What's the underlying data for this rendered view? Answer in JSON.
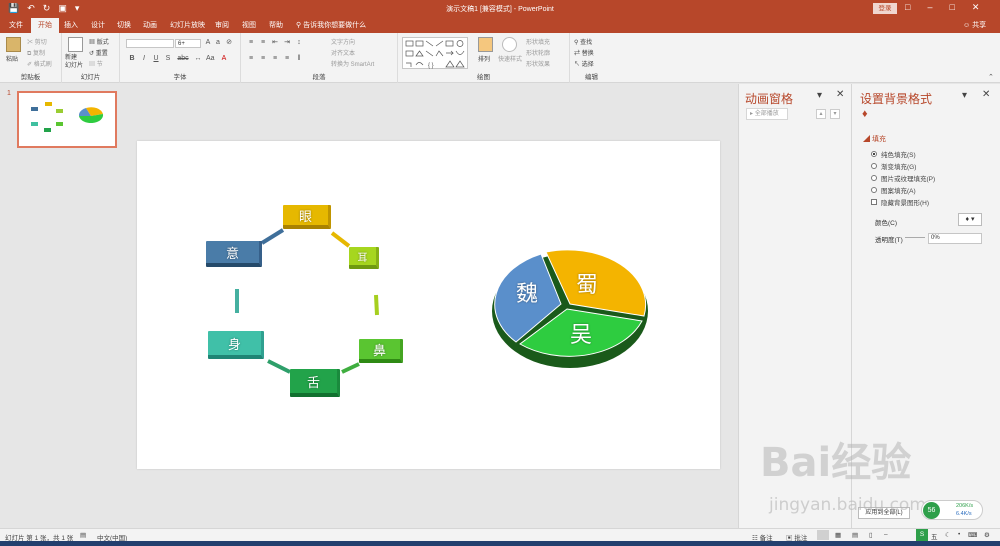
{
  "window": {
    "title": "演示文稿1 [兼容模式] - PowerPoint",
    "login_label": "登录",
    "share_label": "共享"
  },
  "tabs": [
    "文件",
    "开始",
    "插入",
    "设计",
    "切换",
    "动画",
    "幻灯片放映",
    "审阅",
    "视图",
    "帮助"
  ],
  "active_tab": "开始",
  "tell_me": "告诉我你想要做什么",
  "ribbon": {
    "clipboard": {
      "paste": "粘贴",
      "cut": "剪切",
      "copy": "复制",
      "format_painter": "格式刷",
      "label": "剪贴板"
    },
    "slides": {
      "new_slide": "新建\n幻灯片",
      "layout": "版式",
      "reset": "重置",
      "section": "节",
      "label": "幻灯片"
    },
    "font": {
      "size": "6+",
      "label": "字体",
      "bold": "B",
      "italic": "I",
      "underline": "U",
      "shadow": "S",
      "strike": "abc"
    },
    "paragraph": {
      "text_direction": "文字方向",
      "align_text": "对齐文本",
      "smartart": "转换为 SmartArt",
      "label": "段落"
    },
    "drawing": {
      "arrange": "排列",
      "quick_styles": "快速样式",
      "shape_fill": "形状填充",
      "shape_outline": "形状轮廓",
      "shape_effects": "形状效果",
      "label": "绘图"
    },
    "editing": {
      "find": "查找",
      "replace": "替换",
      "select": "选择",
      "label": "编辑"
    }
  },
  "thumbnail": {
    "number": "1"
  },
  "slide": {
    "cycle_labels": {
      "eye": "眼",
      "ear": "耳",
      "nose": "鼻",
      "tongue": "舌",
      "body": "身",
      "mind": "意"
    },
    "pie_labels": {
      "wei": "魏",
      "shu": "蜀",
      "wu": "吴"
    },
    "pie_colors": {
      "wei": "#5a8fcb",
      "shu": "#f4b400",
      "wu": "#2ecc40"
    }
  },
  "animation_pane": {
    "title": "动画窗格",
    "play_all": "全部播放"
  },
  "format_pane": {
    "title": "设置背景格式",
    "section": "填充",
    "options": [
      "纯色填充(S)",
      "渐变填充(G)",
      "图片或纹理填充(P)",
      "图案填充(A)"
    ],
    "selected_option": "纯色填充(S)",
    "hide_graphics": "隐藏背景图形(H)",
    "color_label": "颜色(C)",
    "transparency_label": "透明度(T)",
    "transparency_value": "0%",
    "apply_all": "应用到全部(L)"
  },
  "status": {
    "slide_info": "幻灯片 第 1 张，共 1 张",
    "language": "中文(中国)",
    "notes": "备注",
    "comments": "批注"
  },
  "watermark": {
    "main": "Bai经验",
    "sub": "jingyan.baidu.com"
  },
  "net_widget": {
    "value": "56",
    "up": "206K/s",
    "down": "6.4K/s"
  }
}
